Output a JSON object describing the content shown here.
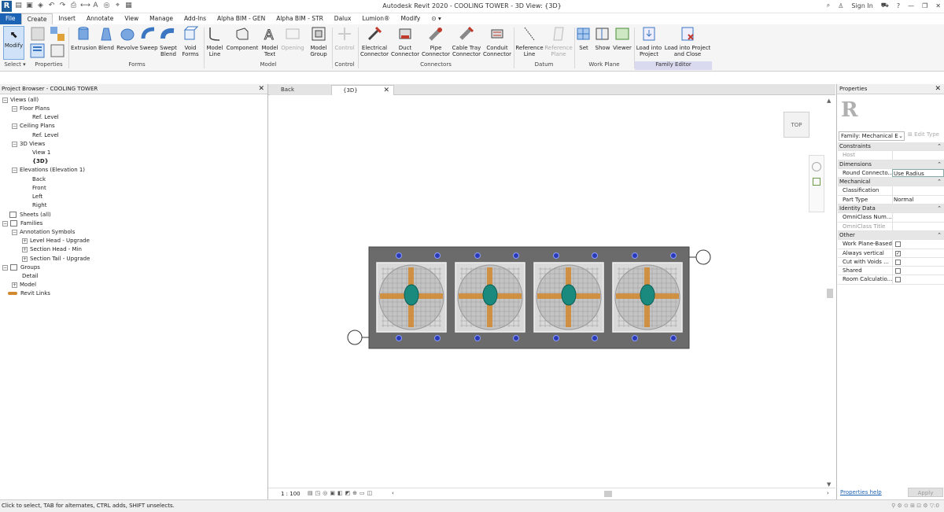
{
  "app": {
    "title": "Autodesk Revit 2020 - COOLING TOWER - 3D View: {3D}",
    "logo": "R",
    "sign_in": "Sign In"
  },
  "menu": {
    "file": "File",
    "tabs": [
      "Create",
      "Insert",
      "Annotate",
      "View",
      "Manage",
      "Add-Ins",
      "Alpha BIM - GEN",
      "Alpha BIM - STR",
      "Dalux",
      "Lumion®",
      "Modify"
    ]
  },
  "ribbon": {
    "modify": "Modify",
    "select_label": "Select ▾",
    "properties_label": "Properties",
    "buttons": [
      {
        "label": "Extrusion"
      },
      {
        "label": "Blend"
      },
      {
        "label": "Revolve"
      },
      {
        "label": "Sweep"
      },
      {
        "label": "Swept Blend"
      },
      {
        "label": "Void Forms"
      },
      {
        "label": "Model Line"
      },
      {
        "label": "Component"
      },
      {
        "label": "Model Text"
      },
      {
        "label": "Opening"
      },
      {
        "label": "Model Group"
      },
      {
        "label": "Control"
      },
      {
        "label": "Electrical Connector"
      },
      {
        "label": "Duct Connector"
      },
      {
        "label": "Pipe Connector"
      },
      {
        "label": "Cable Tray Connector"
      },
      {
        "label": "Conduit Connector"
      },
      {
        "label": "Reference Line"
      },
      {
        "label": "Reference Plane"
      },
      {
        "label": "Set"
      },
      {
        "label": "Show"
      },
      {
        "label": "Viewer"
      },
      {
        "label": "Load into Project"
      },
      {
        "label": "Load into Project and Close"
      }
    ],
    "panels": [
      "Forms",
      "Model",
      "Control",
      "Connectors",
      "Datum",
      "Work Plane",
      "Family Editor"
    ]
  },
  "project_browser": {
    "title": "Project Browser - COOLING TOWER",
    "items": [
      {
        "label": "Views (all)",
        "tg": "−"
      },
      {
        "label": "Floor Plans",
        "tg": "−"
      },
      {
        "label": "Ref. Level",
        "tg": ""
      },
      {
        "label": "Ceiling Plans",
        "tg": "−"
      },
      {
        "label": "Ref. Level",
        "tg": ""
      },
      {
        "label": "3D Views",
        "tg": "−"
      },
      {
        "label": "View 1",
        "tg": ""
      },
      {
        "label": "{3D}",
        "tg": ""
      },
      {
        "label": "Elevations (Elevation 1)",
        "tg": "−"
      },
      {
        "label": "Back",
        "tg": ""
      },
      {
        "label": "Front",
        "tg": ""
      },
      {
        "label": "Left",
        "tg": ""
      },
      {
        "label": "Right",
        "tg": ""
      },
      {
        "label": "Sheets (all)",
        "tg": ""
      },
      {
        "label": "Families",
        "tg": "−"
      },
      {
        "label": "Annotation Symbols",
        "tg": "−"
      },
      {
        "label": "Level Head - Upgrade",
        "tg": "+"
      },
      {
        "label": "Section Head - Min",
        "tg": "+"
      },
      {
        "label": "Section Tail - Upgrade",
        "tg": "+"
      },
      {
        "label": "Groups",
        "tg": "−"
      },
      {
        "label": "Detail",
        "tg": ""
      },
      {
        "label": "Model",
        "tg": "+"
      },
      {
        "label": "Revit Links",
        "tg": ""
      }
    ]
  },
  "view_tabs": {
    "back": "Back",
    "view3d": "{3D}"
  },
  "viewcube": {
    "label": "TOP"
  },
  "view_bar": {
    "scale": "1 : 100"
  },
  "properties": {
    "title": "Properties",
    "family": "Family: Mechanical E",
    "edit_type": "Edit Type",
    "rows": [
      {
        "type": "cat",
        "label": "Constraints"
      },
      {
        "type": "prop",
        "name": "Host",
        "value": "",
        "dim": true
      },
      {
        "type": "cat",
        "label": "Dimensions"
      },
      {
        "type": "prop",
        "name": "Round Connecto...",
        "value": "Use Radius",
        "edit": true
      },
      {
        "type": "cat",
        "label": "Mechanical"
      },
      {
        "type": "prop",
        "name": "Classification",
        "value": ""
      },
      {
        "type": "prop",
        "name": "Part Type",
        "value": "Normal"
      },
      {
        "type": "cat",
        "label": "Identity Data"
      },
      {
        "type": "prop",
        "name": "OmniClass Num...",
        "value": ""
      },
      {
        "type": "prop",
        "name": "OmniClass Title",
        "value": "",
        "dim": true
      },
      {
        "type": "cat",
        "label": "Other"
      },
      {
        "type": "check",
        "name": "Work Plane-Based",
        "checked": false
      },
      {
        "type": "check",
        "name": "Always vertical",
        "checked": true
      },
      {
        "type": "check",
        "name": "Cut with Voids ...",
        "checked": false
      },
      {
        "type": "check",
        "name": "Shared",
        "checked": false
      },
      {
        "type": "check",
        "name": "Room Calculatio...",
        "checked": false
      }
    ],
    "help": "Properties help",
    "apply": "Apply"
  },
  "status": {
    "text": "Click to select, TAB for alternates, CTRL adds, SHIFT unselects."
  },
  "colors": {
    "file_tab": "#1d63b5",
    "model_body": "#6b6b6b",
    "teal": "#1a8a7e",
    "orange": "#d2882e"
  }
}
